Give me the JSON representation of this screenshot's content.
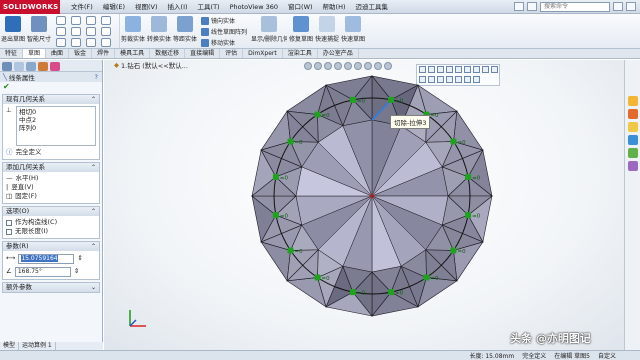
{
  "app": {
    "logo": "SOLIDWORKS",
    "menus": [
      "文件(F)",
      "编辑(E)",
      "视图(V)",
      "插入(I)",
      "工具(T)",
      "PhotoView 360",
      "窗口(W)",
      "帮助(H)",
      "迈迪工具集"
    ],
    "search_placeholder": "搜索命令"
  },
  "ribbon": {
    "exit_sketch": "退出草图",
    "smart_dim": "智能尺寸",
    "trim": "剪裁实体",
    "convert": "转换实体",
    "offset": "等距实体",
    "mirror": "镜向实体",
    "linear_pattern": "线性草图阵列",
    "move": "移动实体",
    "show_hide": "显示/删除几何关系",
    "repair": "修复草图",
    "quick_snap": "快速捕捉",
    "rapid_sketch": "快速草图"
  },
  "command_tabs": [
    "特征",
    "草图",
    "曲面",
    "钣金",
    "焊件",
    "模具工具",
    "数据迁移",
    "直接编辑",
    "评估",
    "DimXpert",
    "渲染工具",
    "办公室产品"
  ],
  "property_manager": {
    "title": "线条属性",
    "help_icon": "?",
    "existing_relations": {
      "header": "现有几何关系",
      "items": [
        "相切0",
        "中点2",
        "阵列0"
      ],
      "status": "完全定义"
    },
    "add_relations": {
      "header": "添加几何关系",
      "items": [
        "水平(H)",
        "竖直(V)",
        "固定(F)"
      ]
    },
    "options": {
      "header": "选项(O)",
      "construction": "作为构造线(C)",
      "infinite": "无限长度(I)"
    },
    "parameters": {
      "header": "参数(R)",
      "length": "15.0759164",
      "angle": "168.75°"
    },
    "extra": {
      "header": "额外参数"
    }
  },
  "bottom_tabs": [
    "模型",
    "运动算例 1"
  ],
  "graphics": {
    "tree_head": "1.钻石 (默认<<默认...",
    "tooltip": "切除-拉伸3",
    "relation_badge": "=0"
  },
  "status_bar": {
    "length": "长度: 15.08mm",
    "definition": "完全定义",
    "editing": "在编辑 草图5",
    "units": "自定义"
  },
  "watermark": "头条 @亦明图记",
  "colors": {
    "gem_fill": "#8c8ea6",
    "gem_edge": "#1a1a22",
    "relation_green": "#1fa31f",
    "title_red": "#c8102e"
  }
}
